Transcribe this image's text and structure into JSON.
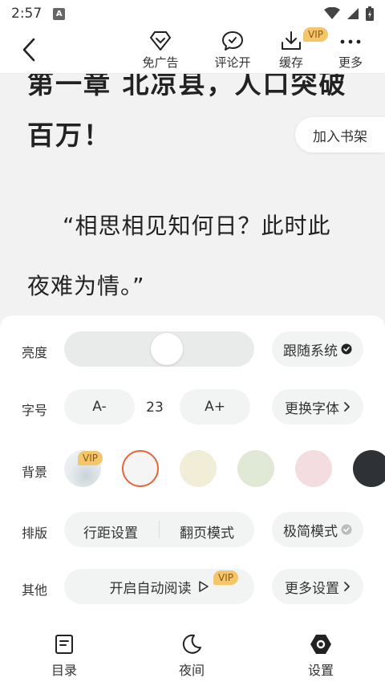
{
  "status": {
    "time": "2:57",
    "app_badge": "A"
  },
  "toolbar": {
    "ad_free": "免广告",
    "comments": "评论开",
    "download": "缓存",
    "download_badge": "VIP",
    "more": "更多"
  },
  "reading": {
    "title_line1": "第一章 北凉县，人口突破",
    "title_line2": "百万！",
    "para_line1": "“相思相见知何日？此时此",
    "para_line2": "夜难为情。”",
    "add_shelf": "加入书架"
  },
  "settings": {
    "brightness": {
      "label": "亮度",
      "level": 0.55,
      "follow_system": "跟随系统"
    },
    "font_size": {
      "label": "字号",
      "decrease": "A-",
      "value": "23",
      "increase": "A+",
      "change_font": "更换字体"
    },
    "background": {
      "label": "背景",
      "vip_badge": "VIP",
      "colors": [
        "#ebeef0",
        "#f5f5f5",
        "#f1edd6",
        "#dfe9d5",
        "#f3dde0",
        "#2e3136"
      ],
      "selected_index": 1,
      "accent": "#e06a3b"
    },
    "layout": {
      "label": "排版",
      "line_spacing": "行距设置",
      "page_mode": "翻页模式",
      "minimal_mode": "极简模式"
    },
    "other": {
      "label": "其他",
      "auto_read": "开启自动阅读",
      "auto_read_badge": "VIP",
      "more_settings": "更多设置"
    }
  },
  "nav": {
    "catalog": "目录",
    "night": "夜间",
    "settings": "设置"
  }
}
